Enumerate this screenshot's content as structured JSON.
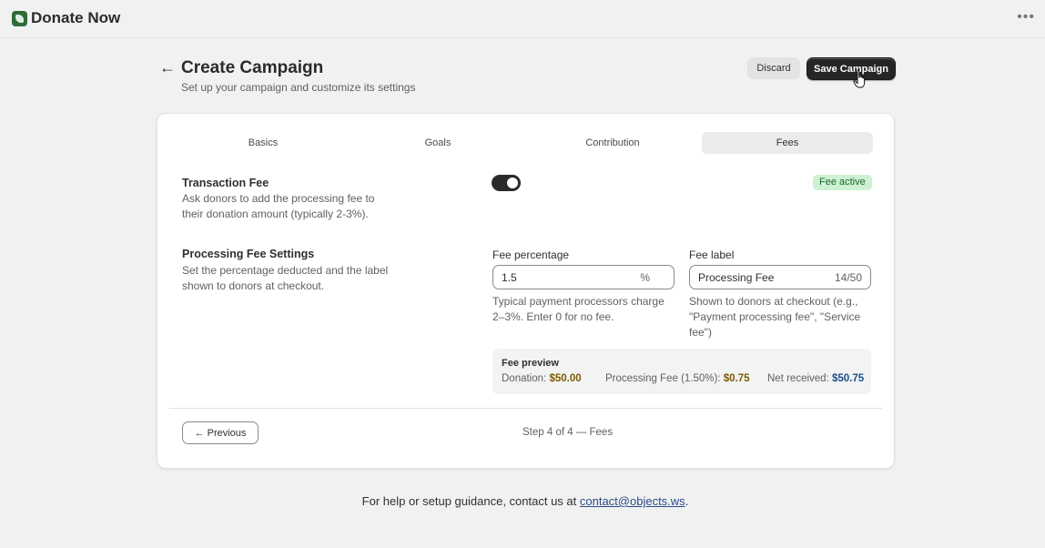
{
  "app": {
    "title": "Donate Now",
    "more_icon": "more-horizontal-icon"
  },
  "header": {
    "back_icon": "←",
    "title": "Create Campaign",
    "subtitle": "Set up your campaign and customize its settings",
    "discard_label": "Discard",
    "save_label": "Save Campaign"
  },
  "tabs": [
    {
      "label": "Basics",
      "active": false
    },
    {
      "label": "Goals",
      "active": false
    },
    {
      "label": "Contribution",
      "active": false
    },
    {
      "label": "Fees",
      "active": true
    }
  ],
  "transaction_fee": {
    "title": "Transaction Fee",
    "description": "Ask donors to add the processing fee to their donation amount (typically 2-3%).",
    "enabled": true,
    "badge": "Fee active"
  },
  "processing": {
    "title": "Processing Fee Settings",
    "description": "Set the percentage deducted and the label shown to donors at checkout.",
    "fee_percentage": {
      "label": "Fee percentage",
      "value": "1.5",
      "suffix": "%",
      "help": "Typical payment processors charge 2–3%. Enter 0 for no fee."
    },
    "fee_label": {
      "label": "Fee label",
      "value": "Processing Fee",
      "counter": "14/50",
      "help": "Shown to donors at checkout (e.g., \"Payment processing fee\", \"Service fee\")"
    }
  },
  "preview": {
    "title": "Fee preview",
    "donation_label": "Donation:",
    "donation_value": "$50.00",
    "fee_label": "Processing Fee (1.50%):",
    "fee_value": "$0.75",
    "net_label": "Net received:",
    "net_value": "$50.75"
  },
  "footer_nav": {
    "previous_label": "← Previous",
    "step_text": "Step 4 of 4 — Fees"
  },
  "footer": {
    "text": "For help or setup guidance, contact us at ",
    "link": "contact@objects.ws",
    "suffix": "."
  },
  "colors": {
    "accent": "#262626",
    "badge_bg": "#cdf1d2",
    "badge_text": "#1b6b2a",
    "brand": "#2e6b3c"
  }
}
